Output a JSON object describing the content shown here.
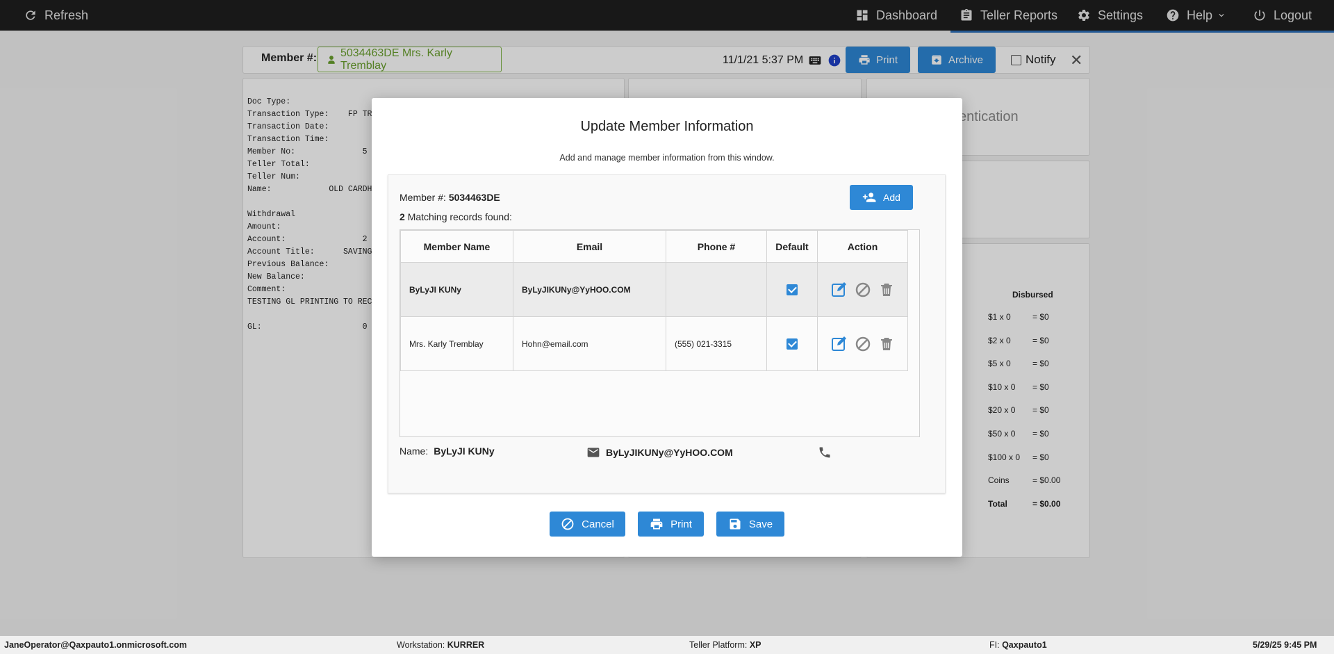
{
  "topbar": {
    "refresh": "Refresh",
    "dashboard": "Dashboard",
    "teller_reports": "Teller Reports",
    "settings": "Settings",
    "help": "Help",
    "logout": "Logout"
  },
  "background": {
    "member_label": "Member #:",
    "member_value": "5034463DE Mrs. Karly Tremblay",
    "datetime": "11/1/21 5:37 PM",
    "print": "Print",
    "archive": "Archive",
    "notify": "Notify",
    "receipt": "Doc Type:\nTransaction Type:    FP TRA\nTransaction Date:\nTransaction Time:\nMember No:              5\nTeller Total:\nTeller Num:\nName:            OLD CARDH\n\nWithdrawal\nAmount:\nAccount:                2\nAccount Title:      SAVINGS\nPrevious Balance:\nNew Balance:\nComment:\nTESTING GL PRINTING TO RECE\n\nGL:                     0",
    "auth_partial": "entication",
    "disbursed_title": "Disbursed",
    "disbursed": [
      {
        "label": "$1 x 0",
        "value": "= $0"
      },
      {
        "label": "$2 x 0",
        "value": "= $0"
      },
      {
        "label": "$5 x 0",
        "value": "= $0"
      },
      {
        "label": "$10 x 0",
        "value": "= $0"
      },
      {
        "label": "$20 x 0",
        "value": "= $0"
      },
      {
        "label": "$50 x 0",
        "value": "= $0"
      },
      {
        "label": "$100 x 0",
        "value": "= $0"
      },
      {
        "label": "Coins",
        "value": "= $0.00"
      },
      {
        "label": "Total",
        "value": "= $0.00"
      }
    ]
  },
  "modal": {
    "title": "Update Member Information",
    "subtitle": "Add and manage member information from this window.",
    "member_label": "Member #:",
    "member_value": "5034463DE",
    "match_count": "2",
    "match_text": "Matching records found:",
    "add": "Add",
    "columns": [
      "Member Name",
      "Email",
      "Phone #",
      "Default",
      "Action"
    ],
    "rows": [
      {
        "name": "ByLyJI KUNy",
        "email": "ByLyJIKUNy@YyHOO.COM",
        "phone": "",
        "default": true
      },
      {
        "name": "Mrs. Karly Tremblay",
        "email": "Hohn@email.com",
        "phone": "(555) 021-3315",
        "default": true
      }
    ],
    "summary": {
      "name_label": "Name:",
      "name_value": "ByLyJI KUNy",
      "email_value": "ByLyJIKUNy@YyHOO.COM"
    },
    "cancel": "Cancel",
    "print": "Print",
    "save": "Save"
  },
  "statusbar": {
    "user": "JaneOperator@Qaxpauto1.onmicrosoft.com",
    "workstation_label": "Workstation:",
    "workstation": "KURRER",
    "platform_label": "Teller Platform:",
    "platform": "XP",
    "fi_label": "FI:",
    "fi": "Qaxpauto1",
    "datetime": "5/29/25 9:45 PM"
  },
  "colors": {
    "primary": "#2e88d6",
    "topbar": "#1f1f1f",
    "member_green": "#6aa12e"
  }
}
